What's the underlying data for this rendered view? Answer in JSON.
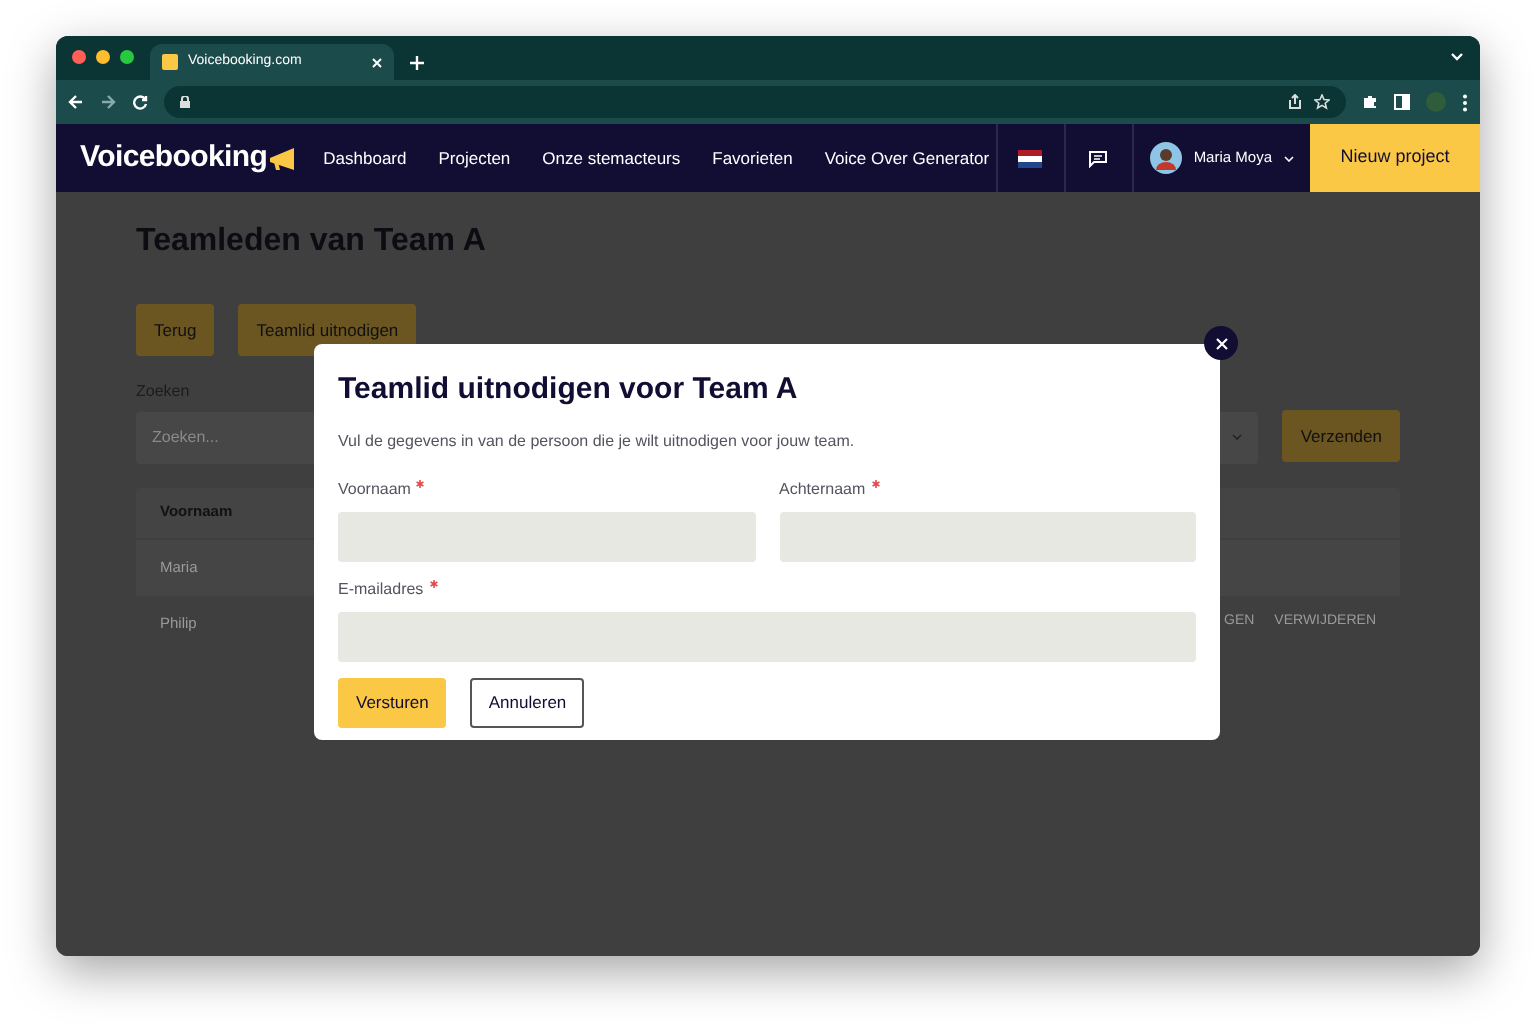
{
  "browser": {
    "tab_title": "Voicebooking.com"
  },
  "nav": {
    "logo": "Voicebooking",
    "items": [
      "Dashboard",
      "Projecten",
      "Onze stemacteurs",
      "Favorieten",
      "Voice Over Generator"
    ],
    "user": "Maria Moya",
    "cta": "Nieuw project"
  },
  "page": {
    "title": "Teamleden van Team A",
    "buttons": [
      "Terug",
      "Teamlid uitnodigen"
    ],
    "search_label": "Zoeken",
    "search_placeholder": "Zoeken...",
    "send_button": "Verzenden",
    "table": {
      "columns": [
        "Voornaam"
      ],
      "rows": [
        {
          "cells": [
            "Maria"
          ],
          "actions": []
        },
        {
          "cells": [
            "Philip"
          ],
          "actions": [
            "GEN",
            "VERWIJDEREN"
          ]
        }
      ]
    }
  },
  "modal": {
    "title": "Teamlid uitnodigen voor Team A",
    "description": "Vul de gegevens in van de persoon die je wilt uitnodigen voor jouw team.",
    "fields": [
      {
        "label": "Voornaam",
        "required": true
      },
      {
        "label": "Achternaam",
        "required": true
      },
      {
        "label": "E-mailadres",
        "required": true
      }
    ],
    "buttons": [
      {
        "label": "Versturen",
        "kind": "primary"
      },
      {
        "label": "Annuleren",
        "kind": "secondary"
      }
    ]
  }
}
